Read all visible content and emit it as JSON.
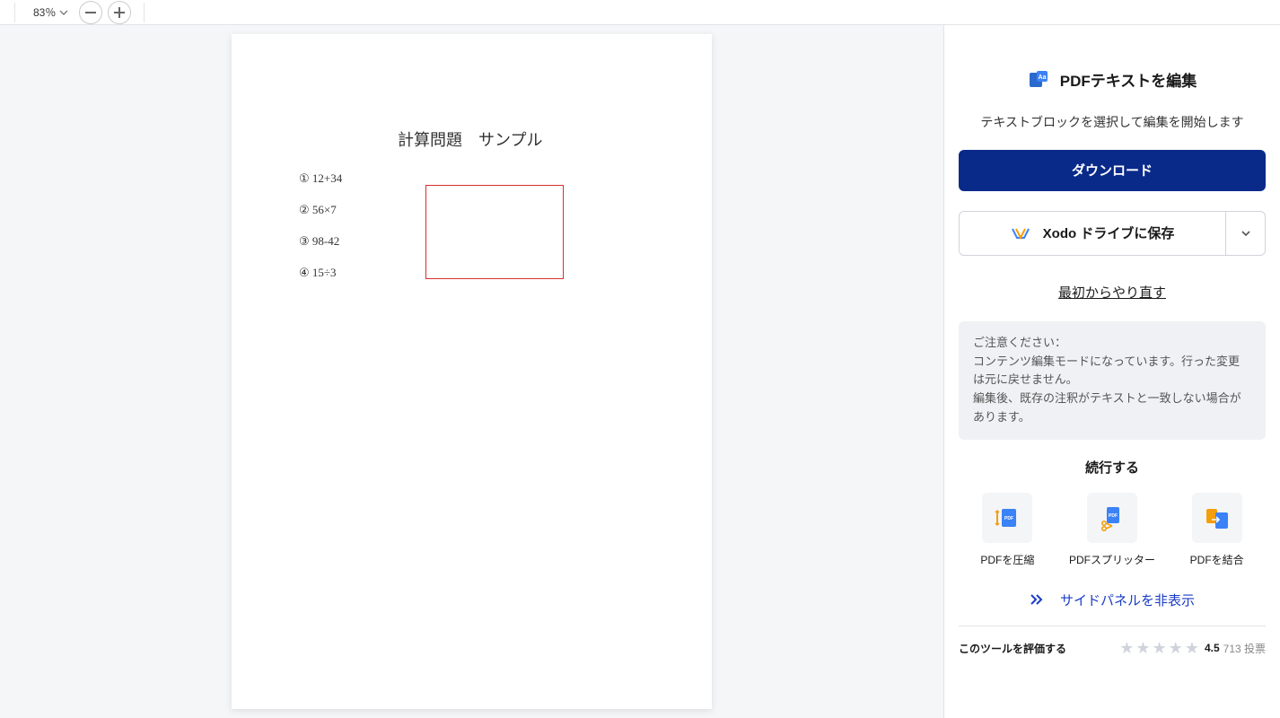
{
  "toolbar": {
    "zoom_value": "83％"
  },
  "document": {
    "title": "計算問題　サンプル",
    "problems": [
      "① 12+34",
      "② 56×7",
      "③ 98-42",
      "④ 15÷3"
    ]
  },
  "side": {
    "title": "PDFテキストを編集",
    "description": "テキストブロックを選択して編集を開始します",
    "download_label": "ダウンロード",
    "save_label": "Xodo ドライブに保存",
    "restart_label": "最初からやり直す",
    "notice_heading": "ご注意ください：",
    "notice_line1": "コンテンツ編集モードになっています。行った変更は元に戻せません。",
    "notice_line2": "編集後、既存の注釈がテキストと一致しない場合があります。",
    "continue_title": "続行する",
    "continue_items": [
      "PDFを圧縮",
      "PDFスプリッター",
      "PDFを結合"
    ],
    "hide_panel_label": "サイドパネルを非表示"
  },
  "rating": {
    "label": "このツールを評価する",
    "score": "4.5",
    "votes": "713 投票"
  },
  "colors": {
    "primary": "#0a2a8a",
    "link": "#1a3cc7",
    "selection": "#d93030"
  }
}
